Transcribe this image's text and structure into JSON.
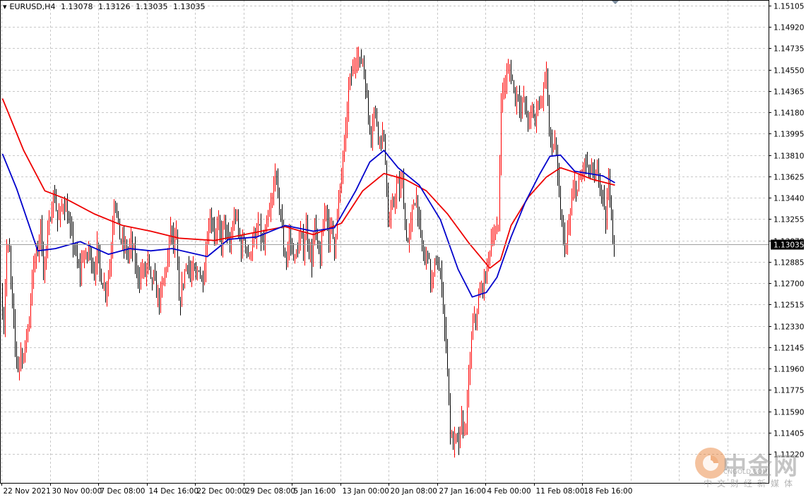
{
  "header": {
    "symbol": "EURUSD,H4",
    "open": "1.13078",
    "high": "1.13126",
    "low": "1.13035",
    "close": "1.13035"
  },
  "current_price_label": "1.13035",
  "watermark": {
    "brand": "中金网",
    "url": "CNGOLD.COM",
    "subtitle": "中文财经新媒体"
  },
  "colors": {
    "bull": "#ff0000",
    "bear": "#000000",
    "ma_fast": "#0000cc",
    "ma_slow": "#ee0000",
    "grid": "#c8c8c8"
  },
  "chart_data": {
    "type": "candlestick",
    "symbol": "EURUSD",
    "timeframe": "H4",
    "ylim": [
      1.1122,
      1.151
    ],
    "y_ticks": [
      "1.15105",
      "1.14920",
      "1.14735",
      "1.14550",
      "1.14365",
      "1.14180",
      "1.13995",
      "1.13810",
      "1.13625",
      "1.13440",
      "1.13255",
      "1.13070",
      "1.12885",
      "1.12700",
      "1.12515",
      "1.12330",
      "1.12145",
      "1.11960",
      "1.11775",
      "1.11590",
      "1.11405",
      "1.11220"
    ],
    "x_ticks": [
      "22 Nov 2021",
      "30 Nov 00:00",
      "7 Dec 08:00",
      "14 Dec 16:00",
      "22 Dec 00:00",
      "29 Dec 08:00",
      "5 Jan 16:00",
      "13 Jan 00:00",
      "20 Jan 08:00",
      "27 Jan 16:00",
      "4 Feb 00:00",
      "11 Feb 08:00",
      "18 Feb 16:00"
    ],
    "grid": true,
    "price_path": [
      [
        0,
        1.126
      ],
      [
        4,
        1.1235
      ],
      [
        8,
        1.13
      ],
      [
        12,
        1.1295
      ],
      [
        16,
        1.125
      ],
      [
        20,
        1.1215
      ],
      [
        24,
        1.1198
      ],
      [
        28,
        1.121
      ],
      [
        32,
        1.1205
      ],
      [
        36,
        1.1225
      ],
      [
        40,
        1.124
      ],
      [
        44,
        1.1275
      ],
      [
        48,
        1.129
      ],
      [
        52,
        1.13
      ],
      [
        56,
        1.132
      ],
      [
        60,
        1.128
      ],
      [
        64,
        1.13
      ],
      [
        68,
        1.132
      ],
      [
        72,
        1.134
      ],
      [
        76,
        1.1345
      ],
      [
        80,
        1.1325
      ],
      [
        84,
        1.133
      ],
      [
        88,
        1.134
      ],
      [
        92,
        1.1335
      ],
      [
        96,
        1.132
      ],
      [
        100,
        1.131
      ],
      [
        104,
        1.13
      ],
      [
        108,
        1.1285
      ],
      [
        112,
        1.128
      ],
      [
        116,
        1.1295
      ],
      [
        120,
        1.129
      ],
      [
        124,
        1.13
      ],
      [
        128,
        1.129
      ],
      [
        132,
        1.128
      ],
      [
        136,
        1.13
      ],
      [
        140,
        1.128
      ],
      [
        144,
        1.127
      ],
      [
        148,
        1.1265
      ],
      [
        152,
        1.1275
      ],
      [
        156,
        1.13
      ],
      [
        160,
        1.1345
      ],
      [
        164,
        1.133
      ],
      [
        168,
        1.131
      ],
      [
        172,
        1.1305
      ],
      [
        176,
        1.13
      ],
      [
        180,
        1.1295
      ],
      [
        184,
        1.1305
      ],
      [
        188,
        1.1295
      ],
      [
        192,
        1.128
      ],
      [
        196,
        1.1275
      ],
      [
        200,
        1.1282
      ],
      [
        204,
        1.1278
      ],
      [
        208,
        1.129
      ],
      [
        212,
        1.127
      ],
      [
        216,
        1.1275
      ],
      [
        220,
        1.1262
      ],
      [
        224,
        1.1255
      ],
      [
        228,
        1.1265
      ],
      [
        232,
        1.128
      ],
      [
        236,
        1.129
      ],
      [
        240,
        1.132
      ],
      [
        244,
        1.13
      ],
      [
        248,
        1.131
      ],
      [
        252,
        1.125
      ],
      [
        256,
        1.1265
      ],
      [
        260,
        1.128
      ],
      [
        264,
        1.129
      ],
      [
        268,
        1.1275
      ],
      [
        272,
        1.128
      ],
      [
        276,
        1.1275
      ],
      [
        280,
        1.1285
      ],
      [
        284,
        1.127
      ],
      [
        288,
        1.1285
      ],
      [
        292,
        1.131
      ],
      [
        296,
        1.133
      ],
      [
        300,
        1.132
      ],
      [
        304,
        1.131
      ],
      [
        308,
        1.132
      ],
      [
        312,
        1.1305
      ],
      [
        316,
        1.1325
      ],
      [
        320,
        1.131
      ],
      [
        324,
        1.13
      ],
      [
        328,
        1.132
      ],
      [
        332,
        1.133
      ],
      [
        336,
        1.1315
      ],
      [
        340,
        1.13
      ],
      [
        344,
        1.131
      ],
      [
        348,
        1.13
      ],
      [
        352,
        1.129
      ],
      [
        356,
        1.131
      ],
      [
        360,
        1.1305
      ],
      [
        364,
        1.132
      ],
      [
        368,
        1.131
      ],
      [
        372,
        1.13
      ],
      [
        376,
        1.132
      ],
      [
        380,
        1.133
      ],
      [
        384,
        1.134
      ],
      [
        388,
        1.137
      ],
      [
        392,
        1.1345
      ],
      [
        396,
        1.133
      ],
      [
        400,
        1.13
      ],
      [
        404,
        1.129
      ],
      [
        408,
        1.131
      ],
      [
        412,
        1.13
      ],
      [
        416,
        1.129
      ],
      [
        420,
        1.13
      ],
      [
        424,
        1.131
      ],
      [
        428,
        1.13
      ],
      [
        432,
        1.132
      ],
      [
        436,
        1.13
      ],
      [
        440,
        1.129
      ],
      [
        444,
        1.132
      ],
      [
        448,
        1.13
      ],
      [
        452,
        1.129
      ],
      [
        456,
        1.132
      ],
      [
        460,
        1.134
      ],
      [
        464,
        1.131
      ],
      [
        468,
        1.132
      ],
      [
        472,
        1.13
      ],
      [
        476,
        1.133
      ],
      [
        480,
        1.135
      ],
      [
        484,
        1.138
      ],
      [
        488,
        1.14
      ],
      [
        492,
        1.144
      ],
      [
        496,
        1.145
      ],
      [
        500,
        1.146
      ],
      [
        504,
        1.147
      ],
      [
        508,
        1.146
      ],
      [
        512,
        1.1465
      ],
      [
        516,
        1.144
      ],
      [
        520,
        1.1415
      ],
      [
        524,
        1.14
      ],
      [
        528,
        1.142
      ],
      [
        532,
        1.141
      ],
      [
        536,
        1.1395
      ],
      [
        540,
        1.14
      ],
      [
        544,
        1.138
      ],
      [
        548,
        1.132
      ],
      [
        552,
        1.133
      ],
      [
        556,
        1.134
      ],
      [
        560,
        1.1355
      ],
      [
        564,
        1.135
      ],
      [
        568,
        1.136
      ],
      [
        572,
        1.132
      ],
      [
        576,
        1.1305
      ],
      [
        580,
        1.132
      ],
      [
        584,
        1.134
      ],
      [
        588,
        1.1345
      ],
      [
        592,
        1.132
      ],
      [
        596,
        1.13
      ],
      [
        600,
        1.129
      ],
      [
        604,
        1.13
      ],
      [
        608,
        1.127
      ],
      [
        612,
        1.1275
      ],
      [
        616,
        1.129
      ],
      [
        620,
        1.128
      ],
      [
        624,
        1.127
      ],
      [
        628,
        1.123
      ],
      [
        632,
        1.12
      ],
      [
        636,
        1.114
      ],
      [
        640,
        1.113
      ],
      [
        644,
        1.1135
      ],
      [
        648,
        1.113
      ],
      [
        652,
        1.115
      ],
      [
        656,
        1.114
      ],
      [
        660,
        1.1165
      ],
      [
        664,
        1.1205
      ],
      [
        668,
        1.1235
      ],
      [
        672,
        1.124
      ],
      [
        676,
        1.1255
      ],
      [
        680,
        1.1265
      ],
      [
        684,
        1.127
      ],
      [
        688,
        1.1285
      ],
      [
        692,
        1.13
      ],
      [
        696,
        1.1315
      ],
      [
        700,
        1.131
      ],
      [
        704,
        1.132
      ],
      [
        708,
        1.143
      ],
      [
        712,
        1.144
      ],
      [
        716,
        1.145
      ],
      [
        720,
        1.1455
      ],
      [
        724,
        1.1445
      ],
      [
        728,
        1.143
      ],
      [
        732,
        1.1435
      ],
      [
        736,
        1.142
      ],
      [
        740,
        1.143
      ],
      [
        744,
        1.1415
      ],
      [
        748,
        1.141
      ],
      [
        752,
        1.142
      ],
      [
        756,
        1.141
      ],
      [
        760,
        1.143
      ],
      [
        764,
        1.1425
      ],
      [
        768,
        1.144
      ],
      [
        772,
        1.1455
      ],
      [
        776,
        1.14
      ],
      [
        780,
        1.1385
      ],
      [
        784,
        1.1395
      ],
      [
        788,
        1.136
      ],
      [
        792,
        1.133
      ],
      [
        796,
        1.131
      ],
      [
        800,
        1.13
      ],
      [
        804,
        1.132
      ],
      [
        808,
        1.134
      ],
      [
        812,
        1.1355
      ],
      [
        816,
        1.135
      ],
      [
        820,
        1.136
      ],
      [
        824,
        1.137
      ],
      [
        828,
        1.1375
      ],
      [
        832,
        1.1365
      ],
      [
        836,
        1.137
      ],
      [
        840,
        1.136
      ],
      [
        844,
        1.1365
      ],
      [
        848,
        1.1355
      ],
      [
        852,
        1.134
      ],
      [
        856,
        1.132
      ],
      [
        860,
        1.136
      ],
      [
        864,
        1.1335
      ],
      [
        867,
        1.13035
      ]
    ],
    "ma_fast": [
      [
        0,
        1.1382
      ],
      [
        20,
        1.1352
      ],
      [
        50,
        1.1298
      ],
      [
        75,
        1.13
      ],
      [
        110,
        1.1306
      ],
      [
        150,
        1.1295
      ],
      [
        180,
        1.13
      ],
      [
        210,
        1.1298
      ],
      [
        240,
        1.13
      ],
      [
        290,
        1.1293
      ],
      [
        320,
        1.1308
      ],
      [
        360,
        1.131
      ],
      [
        400,
        1.132
      ],
      [
        440,
        1.1315
      ],
      [
        470,
        1.1318
      ],
      [
        500,
        1.135
      ],
      [
        520,
        1.1375
      ],
      [
        540,
        1.1385
      ],
      [
        560,
        1.137
      ],
      [
        590,
        1.1355
      ],
      [
        620,
        1.1325
      ],
      [
        645,
        1.1282
      ],
      [
        665,
        1.1258
      ],
      [
        685,
        1.1262
      ],
      [
        700,
        1.1275
      ],
      [
        720,
        1.131
      ],
      [
        740,
        1.134
      ],
      [
        760,
        1.1364
      ],
      [
        775,
        1.138
      ],
      [
        790,
        1.1381
      ],
      [
        810,
        1.1367
      ],
      [
        830,
        1.1365
      ],
      [
        850,
        1.1363
      ],
      [
        867,
        1.1357
      ]
    ],
    "ma_slow": [
      [
        0,
        1.143
      ],
      [
        30,
        1.1385
      ],
      [
        60,
        1.135
      ],
      [
        90,
        1.1343
      ],
      [
        130,
        1.133
      ],
      [
        170,
        1.132
      ],
      [
        210,
        1.1315
      ],
      [
        250,
        1.1309
      ],
      [
        300,
        1.1307
      ],
      [
        350,
        1.1313
      ],
      [
        400,
        1.1319
      ],
      [
        440,
        1.1312
      ],
      [
        480,
        1.1322
      ],
      [
        510,
        1.135
      ],
      [
        540,
        1.1365
      ],
      [
        570,
        1.136
      ],
      [
        600,
        1.135
      ],
      [
        630,
        1.133
      ],
      [
        660,
        1.1305
      ],
      [
        690,
        1.1283
      ],
      [
        705,
        1.129
      ],
      [
        720,
        1.132
      ],
      [
        745,
        1.1345
      ],
      [
        770,
        1.1362
      ],
      [
        790,
        1.137
      ],
      [
        810,
        1.1366
      ],
      [
        835,
        1.136
      ],
      [
        867,
        1.1355
      ]
    ]
  }
}
